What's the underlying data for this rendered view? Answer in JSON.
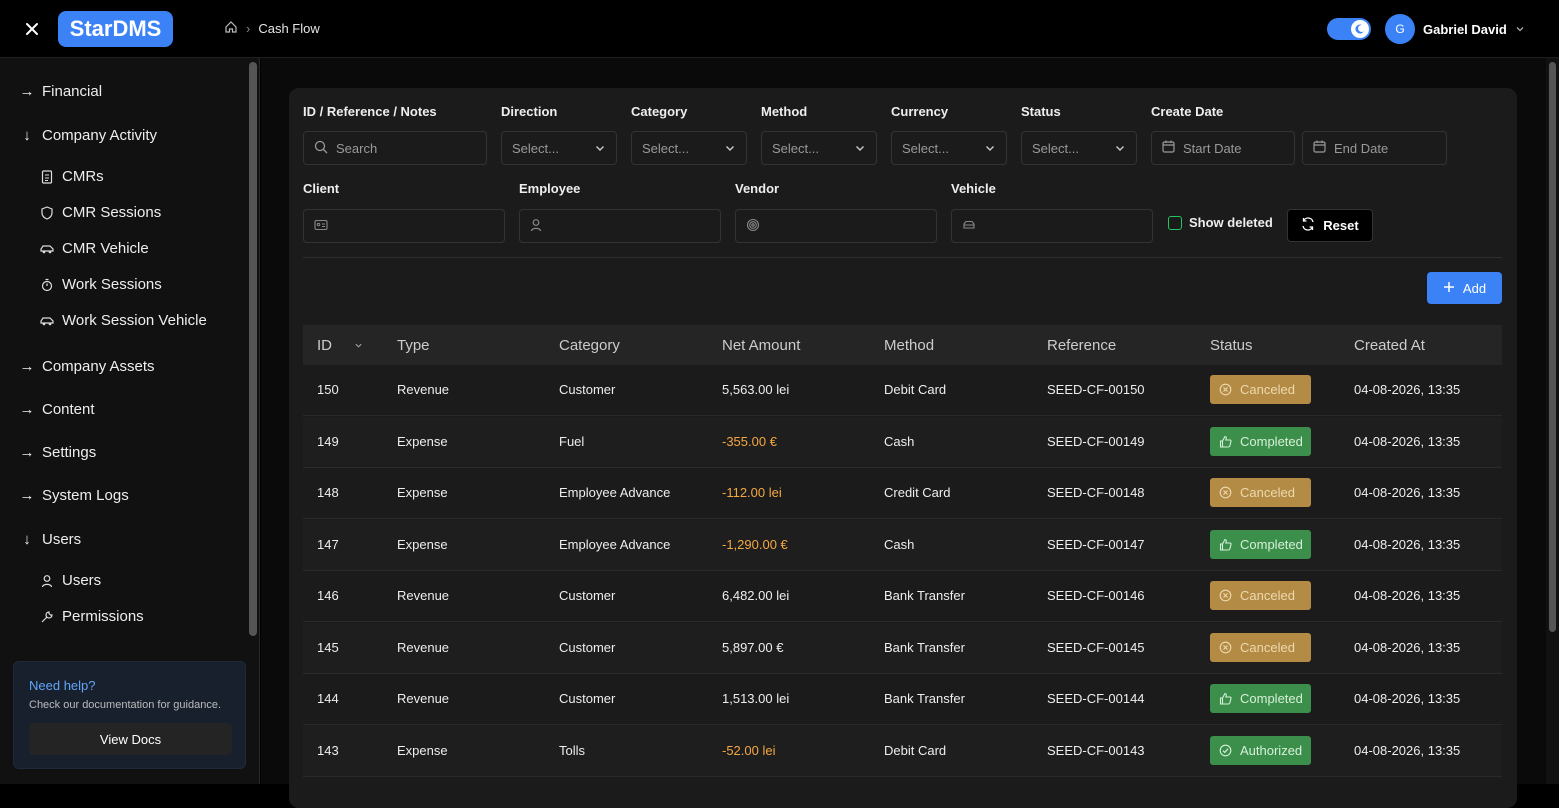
{
  "app": {
    "logo": "StarDMS"
  },
  "breadcrumb": {
    "current": "Cash Flow"
  },
  "user": {
    "initial": "G",
    "name": "Gabriel David"
  },
  "sidebar": {
    "financial": "Financial",
    "company_activity": "Company Activity",
    "cmrs": "CMRs",
    "cmr_sessions": "CMR Sessions",
    "cmr_vehicle": "CMR Vehicle",
    "work_sessions": "Work Sessions",
    "work_session_vehicle": "Work Session Vehicle",
    "company_assets": "Company Assets",
    "content": "Content",
    "settings": "Settings",
    "system_logs": "System Logs",
    "users_group": "Users",
    "users": "Users",
    "permissions": "Permissions"
  },
  "help": {
    "title": "Need help?",
    "desc": "Check our documentation for guidance.",
    "button": "View Docs"
  },
  "filters": {
    "id_label": "ID / Reference / Notes",
    "search_placeholder": "Search",
    "direction_label": "Direction",
    "category_label": "Category",
    "method_label": "Method",
    "currency_label": "Currency",
    "status_label": "Status",
    "create_date_label": "Create Date",
    "select_placeholder": "Select...",
    "start_date": "Start Date",
    "end_date": "End Date",
    "client_label": "Client",
    "employee_label": "Employee",
    "vendor_label": "Vendor",
    "vehicle_label": "Vehicle",
    "show_deleted": "Show deleted",
    "reset": "Reset",
    "add": "Add"
  },
  "table": {
    "headers": [
      "ID",
      "Type",
      "Category",
      "Net Amount",
      "Method",
      "Reference",
      "Status",
      "Created At"
    ],
    "rows": [
      {
        "id": "150",
        "type": "Revenue",
        "category": "Customer",
        "amount": "5,563.00 lei",
        "neg": false,
        "method": "Debit Card",
        "ref": "SEED-CF-00150",
        "status": "Canceled",
        "created": "04-08-2026, 13:35"
      },
      {
        "id": "149",
        "type": "Expense",
        "category": "Fuel",
        "amount": "-355.00 €",
        "neg": true,
        "method": "Cash",
        "ref": "SEED-CF-00149",
        "status": "Completed",
        "created": "04-08-2026, 13:35"
      },
      {
        "id": "148",
        "type": "Expense",
        "category": "Employee Advance",
        "amount": "-112.00 lei",
        "neg": true,
        "method": "Credit Card",
        "ref": "SEED-CF-00148",
        "status": "Canceled",
        "created": "04-08-2026, 13:35"
      },
      {
        "id": "147",
        "type": "Expense",
        "category": "Employee Advance",
        "amount": "-1,290.00 €",
        "neg": true,
        "method": "Cash",
        "ref": "SEED-CF-00147",
        "status": "Completed",
        "created": "04-08-2026, 13:35"
      },
      {
        "id": "146",
        "type": "Revenue",
        "category": "Customer",
        "amount": "6,482.00 lei",
        "neg": false,
        "method": "Bank Transfer",
        "ref": "SEED-CF-00146",
        "status": "Canceled",
        "created": "04-08-2026, 13:35"
      },
      {
        "id": "145",
        "type": "Revenue",
        "category": "Customer",
        "amount": "5,897.00 €",
        "neg": false,
        "method": "Bank Transfer",
        "ref": "SEED-CF-00145",
        "status": "Canceled",
        "created": "04-08-2026, 13:35"
      },
      {
        "id": "144",
        "type": "Revenue",
        "category": "Customer",
        "amount": "1,513.00 lei",
        "neg": false,
        "method": "Bank Transfer",
        "ref": "SEED-CF-00144",
        "status": "Completed",
        "created": "04-08-2026, 13:35"
      },
      {
        "id": "143",
        "type": "Expense",
        "category": "Tolls",
        "amount": "-52.00 lei",
        "neg": true,
        "method": "Debit Card",
        "ref": "SEED-CF-00143",
        "status": "Authorized",
        "created": "04-08-2026, 13:35"
      }
    ]
  },
  "colors": {
    "accent": "#3b82f6",
    "negative": "#f5a742",
    "canceled": "#b38b44",
    "completed": "#3c8f4a"
  }
}
